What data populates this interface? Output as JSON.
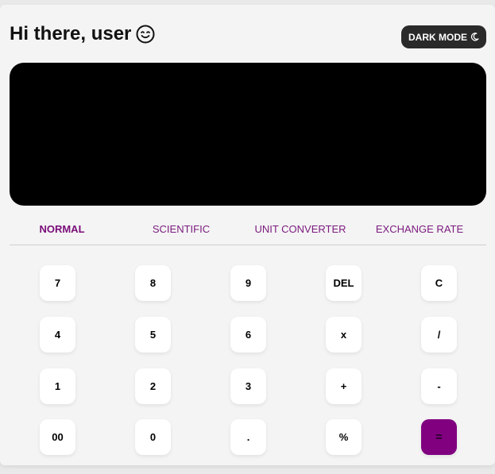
{
  "header": {
    "greeting": "Hi there, user",
    "greeting_icon": "smiling-face-icon",
    "dark_mode_label": "DARK MODE",
    "dark_mode_icon": "moon-icon"
  },
  "display": {
    "value": ""
  },
  "tabs": [
    {
      "label": "NORMAL",
      "active": true
    },
    {
      "label": "SCIENTIFIC",
      "active": false
    },
    {
      "label": "UNIT CONVERTER",
      "active": false
    },
    {
      "label": "EXCHANGE RATE",
      "active": false
    }
  ],
  "keypad": {
    "rows": [
      [
        "7",
        "8",
        "9",
        "DEL",
        "C"
      ],
      [
        "4",
        "5",
        "6",
        "x",
        "/"
      ],
      [
        "1",
        "2",
        "3",
        "+",
        "-"
      ],
      [
        "00",
        "0",
        ".",
        "%",
        "="
      ]
    ]
  },
  "colors": {
    "accent": "#800080",
    "display_bg": "#000000",
    "dark_button_bg": "#2a2a2a"
  }
}
